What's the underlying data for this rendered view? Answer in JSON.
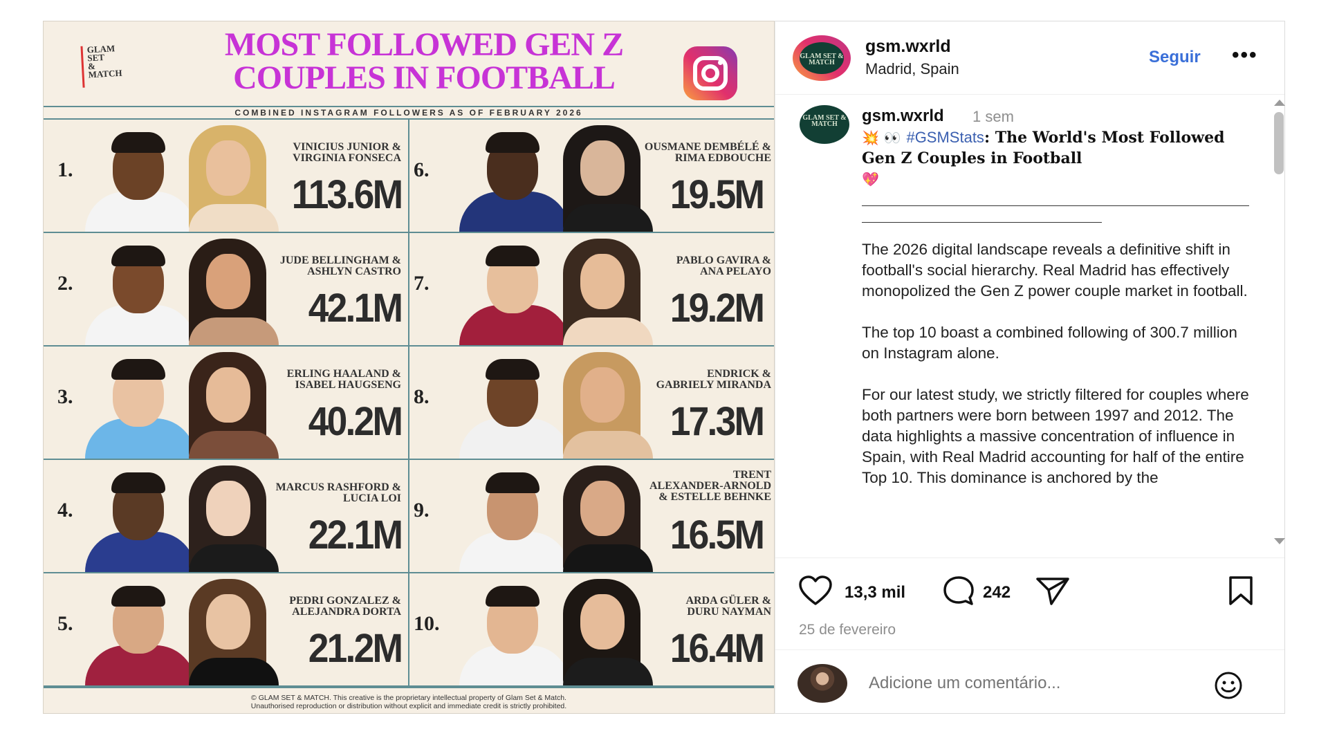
{
  "image": {
    "brand_logo": [
      "GLAM",
      "SET",
      "&",
      "MATCH"
    ],
    "title_line1": "MOST FOLLOWED GEN Z",
    "title_line2": "COUPLES IN FOOTBALL",
    "subtitle": "COMBINED INSTAGRAM FOLLOWERS AS OF FEBRUARY 2026",
    "footer_line1": "© GLAM SET & MATCH. This creative is the proprietary intellectual property of Glam Set & Match.",
    "footer_line2": "Unauthorised reproduction or distribution without explicit and immediate credit is strictly prohibited.",
    "entries": [
      {
        "rank": "1.",
        "line1": "VINICIUS JUNIOR &",
        "line2": "VIRGINIA FONSECA",
        "line3": "",
        "count": "113.6M"
      },
      {
        "rank": "2.",
        "line1": "JUDE BELLINGHAM &",
        "line2": "ASHLYN CASTRO",
        "line3": "",
        "count": "42.1M"
      },
      {
        "rank": "3.",
        "line1": "ERLING HAALAND &",
        "line2": "ISABEL HAUGSENG",
        "line3": "",
        "count": "40.2M"
      },
      {
        "rank": "4.",
        "line1": "MARCUS RASHFORD &",
        "line2": "LUCIA LOI",
        "line3": "",
        "count": "22.1M"
      },
      {
        "rank": "5.",
        "line1": "PEDRI GONZALEZ &",
        "line2": "ALEJANDRA DORTA",
        "line3": "",
        "count": "21.2M"
      },
      {
        "rank": "6.",
        "line1": "OUSMANE DEMBÉLÉ &",
        "line2": "RIMA EDBOUCHE",
        "line3": "",
        "count": "19.5M"
      },
      {
        "rank": "7.",
        "line1": "PABLO GAVIRA &",
        "line2": "ANA PELAYO",
        "line3": "",
        "count": "19.2M"
      },
      {
        "rank": "8.",
        "line1": "ENDRICK &",
        "line2": "GABRIELY MIRANDA",
        "line3": "",
        "count": "17.3M"
      },
      {
        "rank": "9.",
        "line1": "TRENT",
        "line2": "ALEXANDER-ARNOLD",
        "line3": "& ESTELLE BEHNKE",
        "count": "16.5M"
      },
      {
        "rank": "10.",
        "line1": "ARDA GÜLER &",
        "line2": "DURU NAYMAN",
        "line3": "",
        "count": "16.4M"
      }
    ]
  },
  "header": {
    "avatar_text": "GLAM SET & MATCH",
    "username": "gsm.wxrld",
    "location": "Madrid, Spain",
    "follow_label": "Seguir",
    "more_label": "•••"
  },
  "caption": {
    "username": "gsm.wxrld",
    "time": "1 sem",
    "emoji_lead": "💥 👀",
    "hashtag": "#GSMStats",
    "title": ": The World's Most Followed Gen Z Couples in Football",
    "emoji_trail": "💖",
    "paragraph1": "The 2026 digital landscape reveals a definitive shift in football's social hierarchy. Real Madrid has effectively monopolized the Gen Z power couple market in football.",
    "paragraph2": "The top 10 boast a combined following of 300.7 million on Instagram alone.",
    "paragraph3": "For our latest study, we strictly filtered for couples where both partners were born between 1997 and 2012. The data highlights a massive concentration of influence in Spain, with Real Madrid accounting for half of the entire Top 10. This dominance is anchored by the"
  },
  "actions": {
    "like_count": "13,3 mil",
    "comment_count": "242",
    "date": "25 de fevereiro"
  },
  "comment": {
    "placeholder": "Adicione um comentário..."
  },
  "icons": {
    "like": "heart-icon",
    "comment": "comment-icon",
    "share": "send-icon",
    "save": "bookmark-icon",
    "emoji": "smiley-icon"
  },
  "colors": {
    "title_magenta": "#c733d6",
    "teal_rule": "#5e8d93",
    "follow_blue": "#3a6fd8",
    "hashtag_blue": "#3a5fb0"
  }
}
